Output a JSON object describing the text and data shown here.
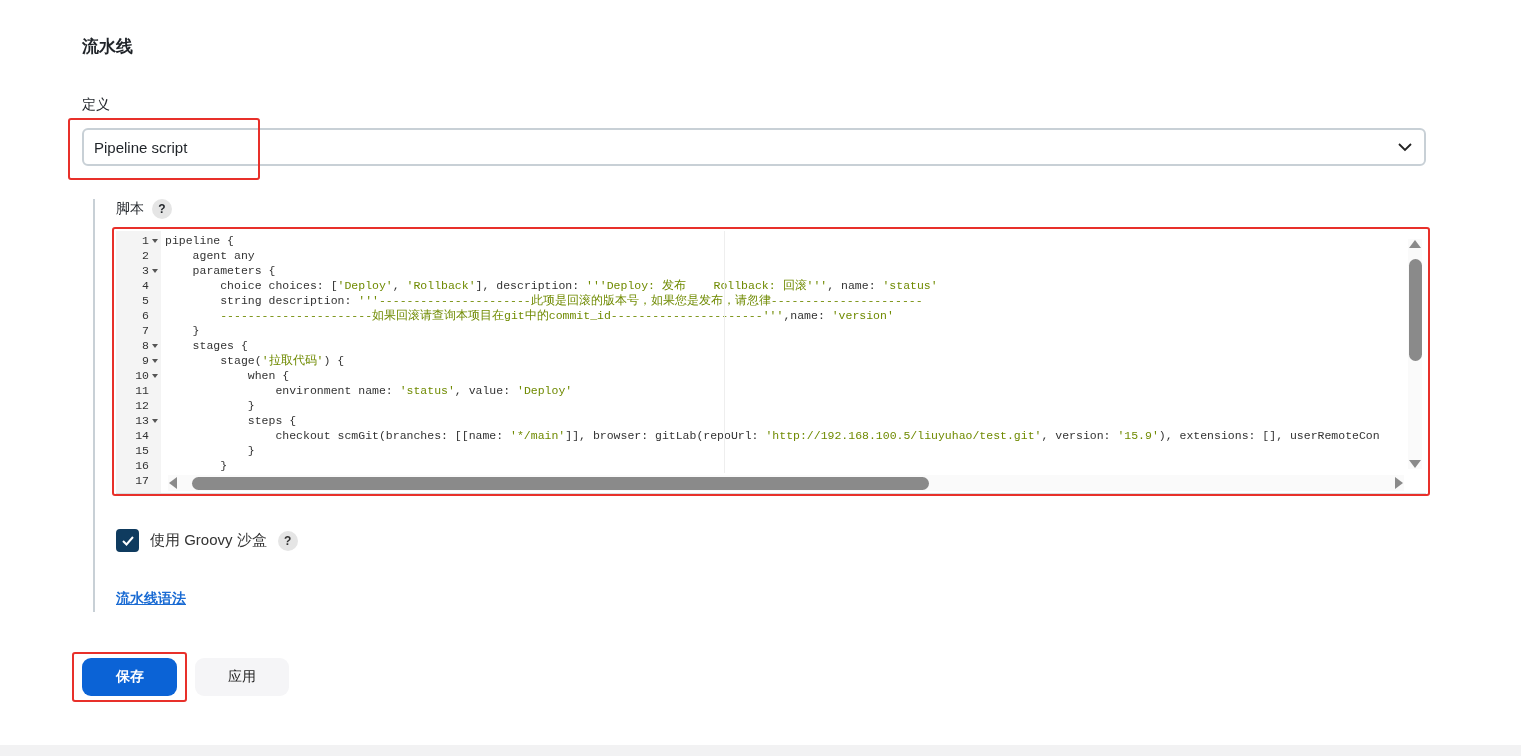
{
  "section_title": "流水线",
  "definition": {
    "label": "定义",
    "value": "Pipeline script",
    "highlighted": true
  },
  "script": {
    "label": "脚本",
    "help": "?",
    "highlighted": true,
    "lines": [
      {
        "number": "1",
        "foldable": true,
        "tokens": [
          {
            "kind": "plain",
            "text": "pipeline {"
          }
        ]
      },
      {
        "number": "2",
        "foldable": false,
        "tokens": [
          {
            "kind": "plain",
            "text": "    agent any"
          }
        ]
      },
      {
        "number": "3",
        "foldable": true,
        "tokens": [
          {
            "kind": "plain",
            "text": "    parameters {"
          }
        ]
      },
      {
        "number": "4",
        "foldable": false,
        "tokens": [
          {
            "kind": "plain",
            "text": "        choice choices: ["
          },
          {
            "kind": "string",
            "text": "'Deploy'"
          },
          {
            "kind": "plain",
            "text": ", "
          },
          {
            "kind": "string",
            "text": "'Rollback'"
          },
          {
            "kind": "plain",
            "text": "], description: "
          },
          {
            "kind": "string",
            "text": "'''Deploy: 发布    Rollback: 回滚'''"
          },
          {
            "kind": "plain",
            "text": ", name: "
          },
          {
            "kind": "string",
            "text": "'status'"
          }
        ]
      },
      {
        "number": "5",
        "foldable": false,
        "tokens": [
          {
            "kind": "plain",
            "text": "        string description: "
          },
          {
            "kind": "string",
            "text": "'''----------------------此项是回滚的版本号，如果您是发布，请忽律----------------------"
          }
        ]
      },
      {
        "number": "6",
        "foldable": false,
        "tokens": [
          {
            "kind": "string",
            "text": "        ----------------------如果回滚请查询本项目在git中的commit_id----------------------'''"
          },
          {
            "kind": "plain",
            "text": ",name: "
          },
          {
            "kind": "string",
            "text": "'version'"
          }
        ]
      },
      {
        "number": "7",
        "foldable": false,
        "tokens": [
          {
            "kind": "plain",
            "text": "    }"
          }
        ]
      },
      {
        "number": "8",
        "foldable": true,
        "tokens": [
          {
            "kind": "plain",
            "text": "    stages {"
          }
        ]
      },
      {
        "number": "9",
        "foldable": true,
        "tokens": [
          {
            "kind": "plain",
            "text": "        stage("
          },
          {
            "kind": "string",
            "text": "'拉取代码'"
          },
          {
            "kind": "plain",
            "text": ") {"
          }
        ]
      },
      {
        "number": "10",
        "foldable": true,
        "tokens": [
          {
            "kind": "plain",
            "text": "            when {"
          }
        ]
      },
      {
        "number": "11",
        "foldable": false,
        "tokens": [
          {
            "kind": "plain",
            "text": "                environment name: "
          },
          {
            "kind": "string",
            "text": "'status'"
          },
          {
            "kind": "plain",
            "text": ", value: "
          },
          {
            "kind": "string",
            "text": "'Deploy'"
          }
        ]
      },
      {
        "number": "12",
        "foldable": false,
        "tokens": [
          {
            "kind": "plain",
            "text": "            }"
          }
        ]
      },
      {
        "number": "13",
        "foldable": true,
        "tokens": [
          {
            "kind": "plain",
            "text": "            steps {"
          }
        ]
      },
      {
        "number": "14",
        "foldable": false,
        "tokens": [
          {
            "kind": "plain",
            "text": "                checkout scmGit(branches: [[name: "
          },
          {
            "kind": "string",
            "text": "'*/main'"
          },
          {
            "kind": "plain",
            "text": "]], browser: gitLab(repoUrl: "
          },
          {
            "kind": "string",
            "text": "'http://192.168.100.5/liuyuhao/test.git'"
          },
          {
            "kind": "plain",
            "text": ", version: "
          },
          {
            "kind": "string",
            "text": "'15.9'"
          },
          {
            "kind": "plain",
            "text": "), extensions: [], userRemoteCon"
          }
        ]
      },
      {
        "number": "15",
        "foldable": false,
        "tokens": [
          {
            "kind": "plain",
            "text": "            }"
          }
        ]
      },
      {
        "number": "16",
        "foldable": false,
        "tokens": [
          {
            "kind": "plain",
            "text": "        }"
          }
        ]
      },
      {
        "number": "17",
        "foldable": false
      }
    ]
  },
  "sandbox": {
    "label": "使用 Groovy 沙盒",
    "checked": true,
    "help": "?"
  },
  "syntax_link": "流水线语法",
  "buttons": [
    {
      "label": "保存",
      "kind": "primary",
      "highlighted": true
    },
    {
      "label": "应用",
      "kind": "secondary",
      "highlighted": false
    }
  ]
}
